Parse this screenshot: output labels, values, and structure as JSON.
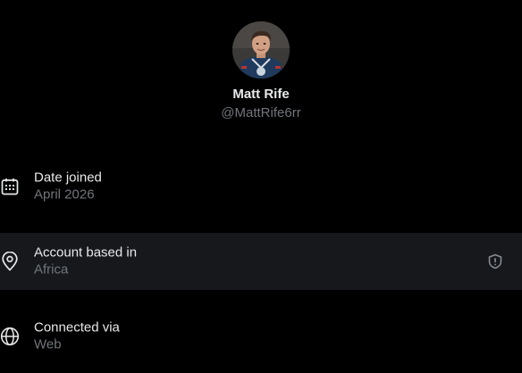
{
  "profile": {
    "name": "Matt Rife",
    "handle": "@MattRife6rr"
  },
  "rows": [
    {
      "label": "Date joined",
      "value": "April 2026",
      "icon": "calendar-icon"
    },
    {
      "label": "Account based in",
      "value": "Africa",
      "icon": "location-pin-icon",
      "trailing_icon": "shield-alert-icon"
    },
    {
      "label": "Connected via",
      "value": "Web",
      "icon": "globe-icon"
    }
  ],
  "colors": {
    "background": "#000000",
    "highlight_row": "#16181c",
    "primary_text": "#e7e9ea",
    "secondary_text": "#71767b"
  }
}
